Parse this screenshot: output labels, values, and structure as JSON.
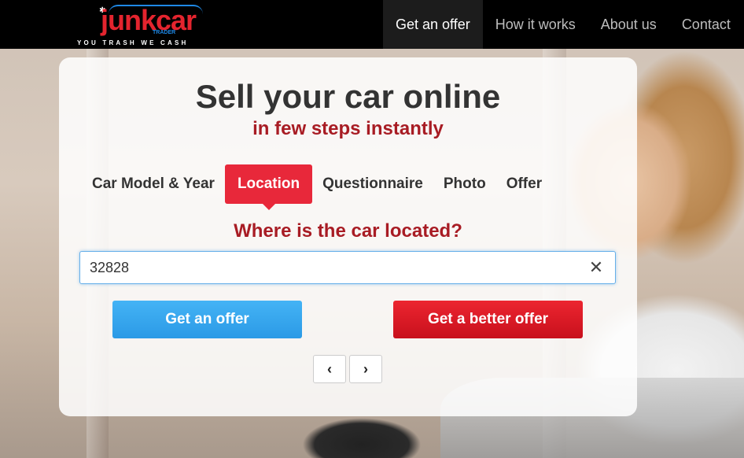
{
  "brand": {
    "logo_text": "junkcar",
    "logo_sub": "TRADER",
    "tagline": "YOU TRASH WE CASH"
  },
  "nav": {
    "items": [
      {
        "label": "Get an offer",
        "active": true
      },
      {
        "label": "How it works",
        "active": false
      },
      {
        "label": "About us",
        "active": false
      },
      {
        "label": "Contact",
        "active": false
      }
    ]
  },
  "hero": {
    "title": "Sell your car online",
    "subtitle": "in few steps instantly"
  },
  "steps": [
    {
      "label": "Car Model & Year",
      "active": false
    },
    {
      "label": "Location",
      "active": true
    },
    {
      "label": "Questionnaire",
      "active": false
    },
    {
      "label": "Photo",
      "active": false
    },
    {
      "label": "Offer",
      "active": false
    }
  ],
  "form": {
    "question": "Where is the car located?",
    "location_value": "32828",
    "clear_glyph": "✕"
  },
  "buttons": {
    "get_offer": "Get an offer",
    "better_offer": "Get a better offer"
  },
  "pager": {
    "prev_glyph": "‹",
    "next_glyph": "›"
  },
  "colors": {
    "accent_red": "#e8283a",
    "dark_red_text": "#a81c24",
    "blue_button": "#2b9ae6",
    "header_bg": "#000000"
  },
  "icons": [
    "close-icon",
    "chevron-left-icon",
    "chevron-right-icon"
  ]
}
